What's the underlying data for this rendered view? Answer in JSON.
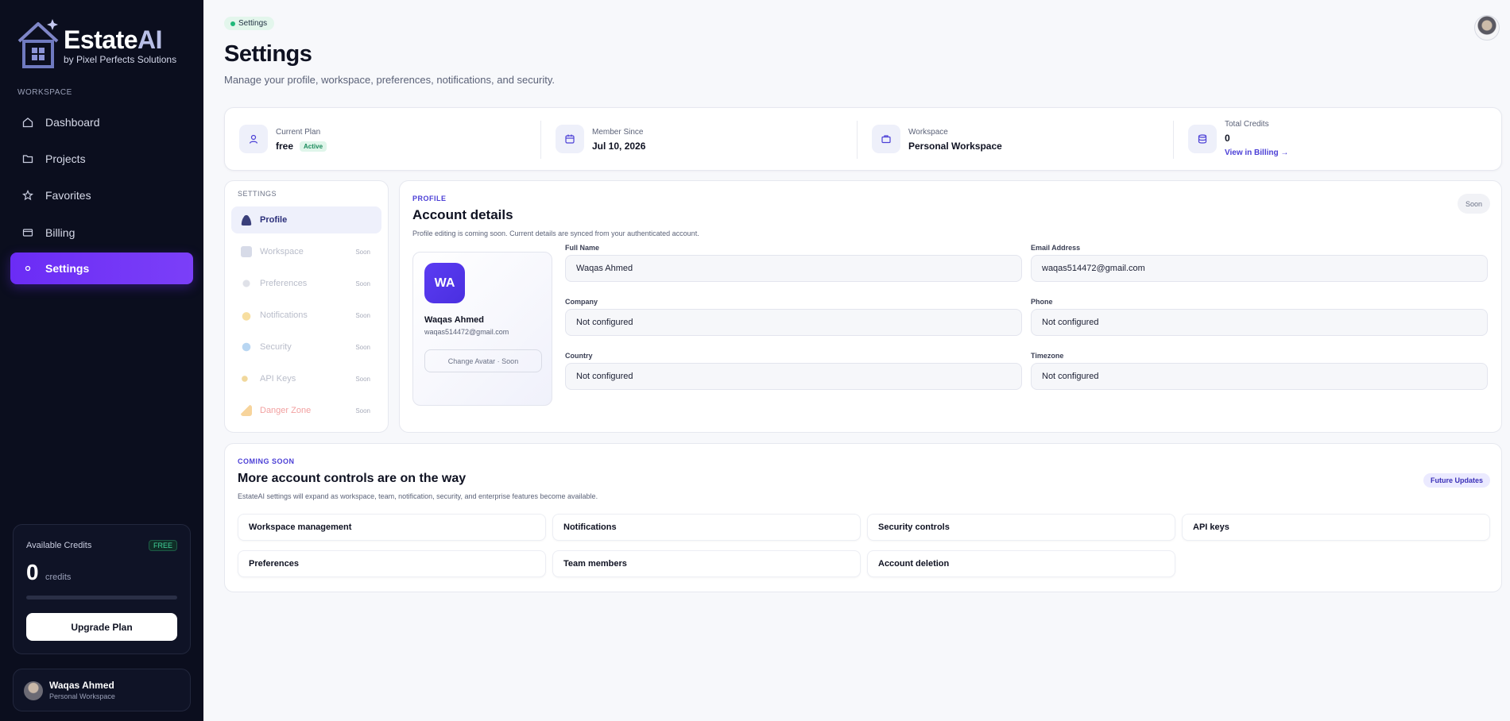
{
  "brand": {
    "title_main": "Estate",
    "title_accent": "AI",
    "subtitle": "by Pixel Perfects Solutions"
  },
  "sidebar": {
    "section_label": "WORKSPACE",
    "items": [
      {
        "label": "Dashboard",
        "icon": "home-icon"
      },
      {
        "label": "Projects",
        "icon": "folder-icon"
      },
      {
        "label": "Favorites",
        "icon": "star-icon"
      },
      {
        "label": "Billing",
        "icon": "credit-card-icon"
      },
      {
        "label": "Settings",
        "icon": "dot-icon",
        "active": true
      }
    ],
    "credits": {
      "title": "Available Credits",
      "badge": "FREE",
      "value": "0",
      "unit": "credits",
      "progress": 0,
      "button": "Upgrade Plan"
    },
    "user": {
      "name": "Waqas Ahmed",
      "workspace": "Personal Workspace"
    }
  },
  "header": {
    "breadcrumb": "Settings",
    "title": "Settings",
    "subtitle": "Manage your profile, workspace, preferences, notifications, and security."
  },
  "stats": [
    {
      "label": "Current Plan",
      "value": "free",
      "badge": "Active",
      "icon": "user-icon"
    },
    {
      "label": "Member Since",
      "value": "Jul 10, 2026",
      "icon": "calendar-icon"
    },
    {
      "label": "Workspace",
      "value": "Personal Workspace",
      "icon": "briefcase-icon"
    },
    {
      "label": "Total Credits",
      "value": "0",
      "link": "View in Billing →",
      "icon": "database-icon"
    }
  ],
  "settings_nav": {
    "heading": "SETTINGS",
    "items": [
      {
        "label": "Profile",
        "status": "",
        "active": true
      },
      {
        "label": "Workspace",
        "status": "Soon"
      },
      {
        "label": "Preferences",
        "status": "Soon"
      },
      {
        "label": "Notifications",
        "status": "Soon"
      },
      {
        "label": "Security",
        "status": "Soon"
      },
      {
        "label": "API Keys",
        "status": "Soon"
      },
      {
        "label": "Danger Zone",
        "status": "Soon"
      }
    ]
  },
  "profile": {
    "kicker": "PROFILE",
    "title": "Account details",
    "description": "Profile editing is coming soon. Current details are synced from your authenticated account.",
    "status": "Soon",
    "avatar_initials": "WA",
    "name": "Waqas Ahmed",
    "email": "waqas514472@gmail.com",
    "change_avatar": "Change Avatar · Soon",
    "fields": [
      {
        "label": "Full Name",
        "value": "Waqas Ahmed"
      },
      {
        "label": "Email Address",
        "value": "waqas514472@gmail.com"
      },
      {
        "label": "Company",
        "value": "Not configured"
      },
      {
        "label": "Phone",
        "value": "Not configured"
      },
      {
        "label": "Country",
        "value": "Not configured"
      },
      {
        "label": "Timezone",
        "value": "Not configured"
      }
    ]
  },
  "coming_soon": {
    "kicker": "COMING SOON",
    "title": "More account controls are on the way",
    "description": "EstateAI settings will expand as workspace, team, notification, security, and enterprise features become available.",
    "badge": "Future Updates",
    "items": [
      "Workspace management",
      "Notifications",
      "Security controls",
      "API keys",
      "Preferences",
      "Team members",
      "Account deletion"
    ]
  },
  "colors": {
    "accent": "#6b2cf5",
    "sidebar_bg": "#0b0e1e",
    "link": "#4b3fd6",
    "success": "#1fb97a"
  }
}
